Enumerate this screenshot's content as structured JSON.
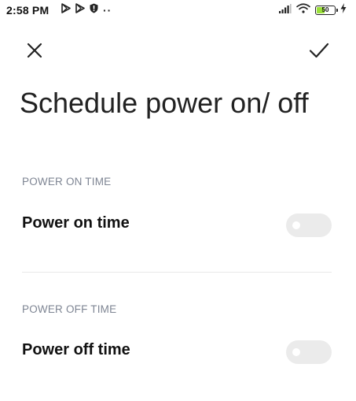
{
  "status_bar": {
    "time": "2:58 PM",
    "battery_level": "50",
    "battery_fraction": 0.5,
    "battery_color": "#9be03a",
    "left_icons": [
      "play-store-icon",
      "play-store-icon",
      "shield-icon",
      "more-dots-icon"
    ],
    "right_icons": [
      "signal-icon",
      "wifi-icon",
      "battery-icon",
      "charging-icon"
    ],
    "dots": "··"
  },
  "action_bar": {
    "close_icon": "close-icon",
    "confirm_icon": "check-icon"
  },
  "page": {
    "title": "Schedule power on/ off"
  },
  "power_on": {
    "section_header": "POWER ON TIME",
    "label": "Power on time",
    "enabled": false
  },
  "power_off": {
    "section_header": "POWER OFF TIME",
    "label": "Power off time",
    "enabled": false
  },
  "colors": {
    "section_header": "#7e8593",
    "toggle_off_track": "#ebebeb",
    "divider": "#e9e9e9"
  }
}
